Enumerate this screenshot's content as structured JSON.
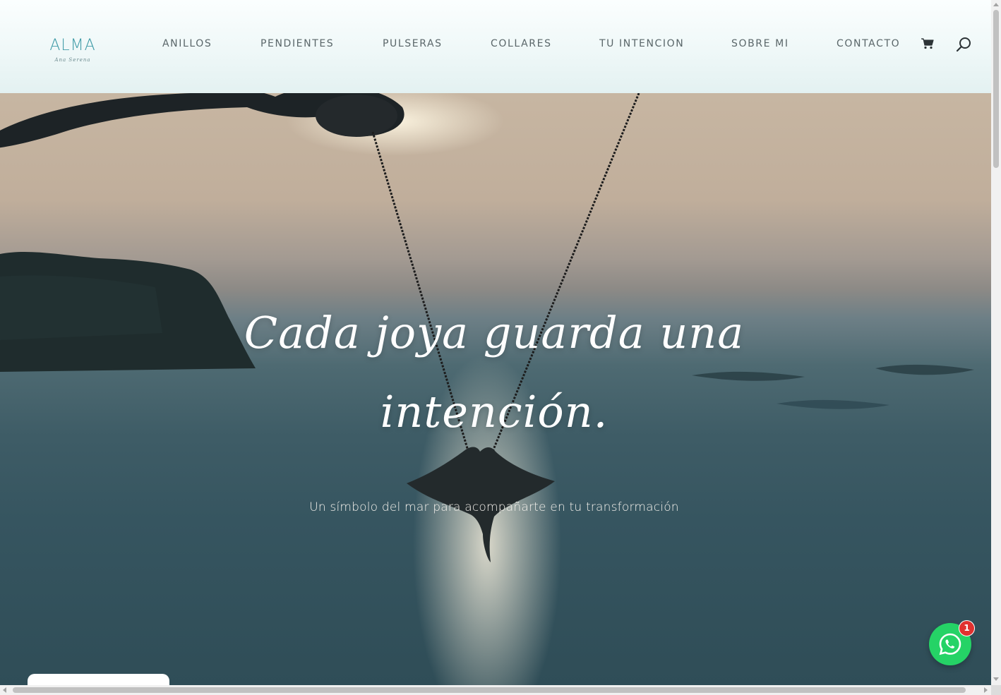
{
  "header": {
    "logo": {
      "main": "ALMA",
      "sub": "Ana Serena"
    },
    "nav": [
      {
        "label": "ANILLOS"
      },
      {
        "label": "PENDIENTES"
      },
      {
        "label": "PULSERAS"
      },
      {
        "label": "COLLARES"
      },
      {
        "label": "TU INTENCION"
      },
      {
        "label": "SOBRE MI"
      },
      {
        "label": "CONTACTO"
      }
    ],
    "cart_icon": "shopping-cart-icon",
    "search_icon": "search-icon"
  },
  "hero": {
    "headline_line1": "Cada joya guarda una",
    "headline_line2": "intención.",
    "subtitle": "Un símbolo del mar para acompañarte en tu transformación"
  },
  "whatsapp": {
    "icon": "whatsapp-icon",
    "badge_count": "1",
    "color": "#25d366",
    "badge_color": "#e0312f"
  },
  "colors": {
    "accent": "#3e9aa6",
    "nav_text": "#5a6669"
  }
}
